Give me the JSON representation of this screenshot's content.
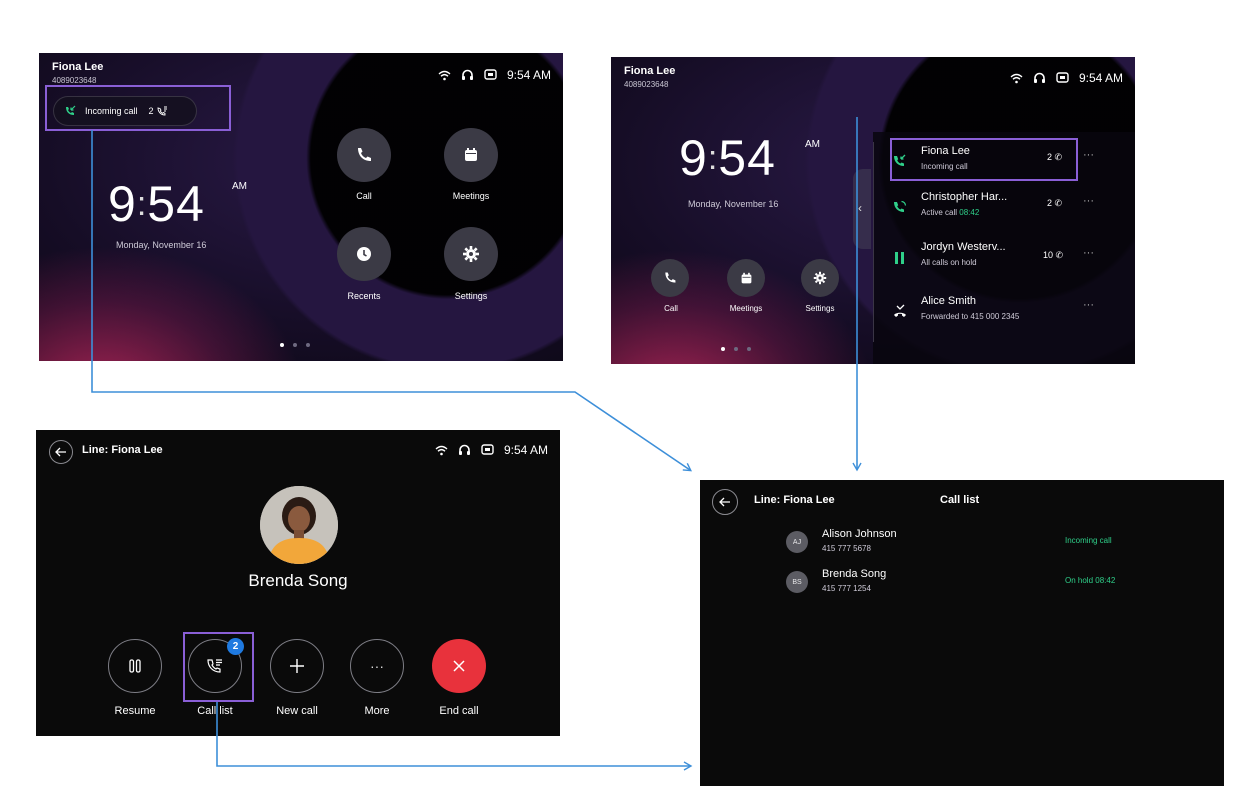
{
  "screen1": {
    "name": "Fiona Lee",
    "number": "4089023648",
    "time": "9:54 AM",
    "incoming_pill": "Incoming call",
    "incoming_count": "2",
    "clock_hh": "9",
    "clock_mm": "54",
    "clock_ampm": "AM",
    "date": "Monday, November 16",
    "buttons": {
      "call": "Call",
      "meetings": "Meetings",
      "recents": "Recents",
      "settings": "Settings"
    }
  },
  "screen2": {
    "name": "Fiona Lee",
    "number": "4089023648",
    "time": "9:54 AM",
    "clock_hh": "9",
    "clock_mm": "54",
    "clock_ampm": "AM",
    "date": "Monday, November 16",
    "buttons": {
      "call": "Call",
      "meetings": "Meetings",
      "settings": "Settings"
    },
    "lines": [
      {
        "title": "Fiona Lee",
        "sub": "Incoming call",
        "count": "2",
        "more": "···"
      },
      {
        "title": "Christopher Har...",
        "sub": "Active call",
        "sub_time": "08:42",
        "count": "2",
        "more": "···"
      },
      {
        "title": "Jordyn Westerv...",
        "sub": "All calls on hold",
        "count": "10",
        "more": "···"
      },
      {
        "title": "Alice Smith",
        "sub": "Forwarded to 415 000 2345",
        "more": "···"
      }
    ]
  },
  "screen3": {
    "title": "Line: Fiona Lee",
    "time": "9:54 AM",
    "contact": "Brenda Song",
    "badge": "2",
    "controls": {
      "resume": "Resume",
      "call_list": "Call list",
      "new_call": "New call",
      "more": "More",
      "end_call": "End call"
    },
    "more_glyph": "···"
  },
  "screen4": {
    "title": "Line: Fiona Lee",
    "heading": "Call list",
    "calls": [
      {
        "initials": "AJ",
        "name": "Alison Johnson",
        "number": "415 777 5678",
        "status": "Incoming call"
      },
      {
        "initials": "BS",
        "name": "Brenda Song",
        "number": "415 777 1254",
        "status": "On hold 08:42"
      }
    ]
  },
  "colors": {
    "accent_green": "#2fd08a",
    "highlight": "#8a5fd6",
    "arrow": "#3d8fd9",
    "end_call": "#e8323c",
    "badge": "#1f7ae0"
  }
}
